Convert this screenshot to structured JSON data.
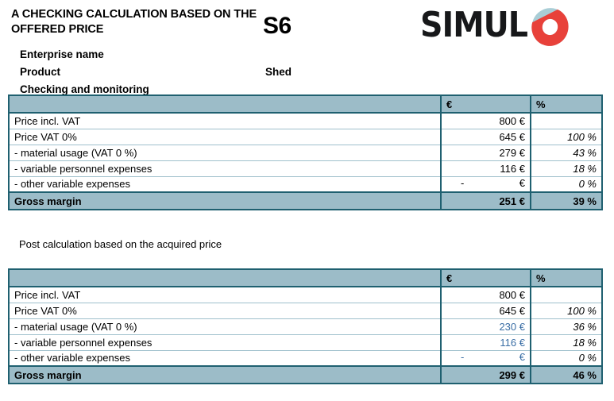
{
  "header": {
    "title": "A CHECKING CALCULATION BASED ON THE OFFERED PRICE",
    "sheet_code": "S6",
    "logo_text": "SIMUL",
    "logo_o_letter": "O",
    "logo_red": "#e8413a",
    "logo_blue": "#a9cdd6",
    "meta": {
      "enterprise_label": "Enterprise name",
      "enterprise_value": "",
      "product_label": "Product",
      "product_value": "Shed",
      "checking_label": "Checking and monitoring"
    }
  },
  "post_calc_label": "Post calculation based on the acquired price",
  "colors": {
    "header_band": "#9cbcc8",
    "border": "#1f6070",
    "row_divider": "#9fc0cc",
    "input_value": "#3a6ea5"
  },
  "tables": [
    {
      "id": "offered",
      "columns": [
        "",
        "€",
        "%"
      ],
      "rows": [
        {
          "label": "Price incl. VAT",
          "indent": false,
          "eur": "800 €",
          "pct": "",
          "eur_input": false,
          "total": false
        },
        {
          "label": "Price VAT 0%",
          "indent": false,
          "eur": "645 €",
          "pct": "100 %",
          "eur_input": false,
          "total": false
        },
        {
          "label": " - material usage (VAT 0 %)",
          "indent": true,
          "eur": "279 €",
          "pct": "43 %",
          "eur_input": false,
          "total": false
        },
        {
          "label": " - variable personnel expenses",
          "indent": true,
          "eur": "116 €",
          "pct": "18 %",
          "eur_input": false,
          "total": false
        },
        {
          "label": " - other variable expenses",
          "indent": true,
          "eur": "-     €",
          "pct": "0 %",
          "eur_input": false,
          "total": false,
          "accounting_zero": true
        },
        {
          "label": "Gross margin",
          "indent": false,
          "eur": "251 €",
          "pct": "39 %",
          "eur_input": false,
          "total": true
        }
      ]
    },
    {
      "id": "acquired",
      "columns": [
        "",
        "€",
        "%"
      ],
      "rows": [
        {
          "label": "Price incl. VAT",
          "indent": false,
          "eur": "800 €",
          "pct": "",
          "eur_input": false,
          "total": false
        },
        {
          "label": "Price VAT 0%",
          "indent": false,
          "eur": "645 €",
          "pct": "100 %",
          "eur_input": false,
          "total": false
        },
        {
          "label": " - material usage (VAT 0 %)",
          "indent": true,
          "eur": "230 €",
          "pct": "36 %",
          "eur_input": true,
          "total": false
        },
        {
          "label": " - variable personnel expenses",
          "indent": true,
          "eur": "116 €",
          "pct": "18 %",
          "eur_input": true,
          "total": false
        },
        {
          "label": " - other variable expenses",
          "indent": true,
          "eur": "-     €",
          "pct": "0 %",
          "eur_input": true,
          "total": false,
          "accounting_zero": true
        },
        {
          "label": "Gross margin",
          "indent": false,
          "eur": "299 €",
          "pct": "46 %",
          "eur_input": false,
          "total": true
        }
      ]
    }
  ]
}
